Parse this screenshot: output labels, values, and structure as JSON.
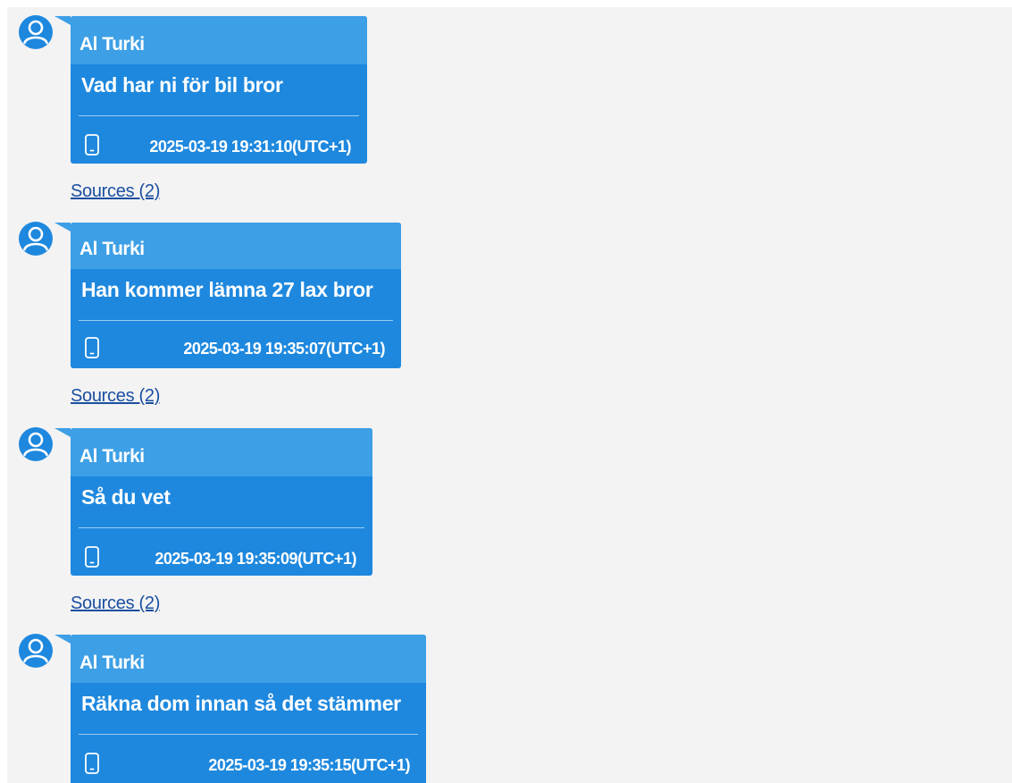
{
  "messages": [
    {
      "sender": "Al Turki",
      "text": "Vad har ni för bil bror",
      "timestamp": "2025-03-19 19:31:10(UTC+1)",
      "device_icon": "phone-icon",
      "sources_label": "Sources (2)"
    },
    {
      "sender": "Al Turki",
      "text": "Han kommer lämna 27 lax bror",
      "timestamp": "2025-03-19 19:35:07(UTC+1)",
      "device_icon": "phone-icon",
      "sources_label": "Sources (2)"
    },
    {
      "sender": "Al Turki",
      "text": "Så du vet",
      "timestamp": "2025-03-19 19:35:09(UTC+1)",
      "device_icon": "phone-icon",
      "sources_label": "Sources (2)"
    },
    {
      "sender": "Al Turki",
      "text": "Räkna dom innan så det stämmer",
      "timestamp": "2025-03-19 19:35:15(UTC+1)",
      "device_icon": "phone-icon",
      "sources_label": ""
    }
  ],
  "colors": {
    "bubble": "#1e88de",
    "bubble_header": "#3d9fe6",
    "avatar": "#1e88de",
    "link": "#1a4fa0",
    "background": "#f3f3f3"
  }
}
